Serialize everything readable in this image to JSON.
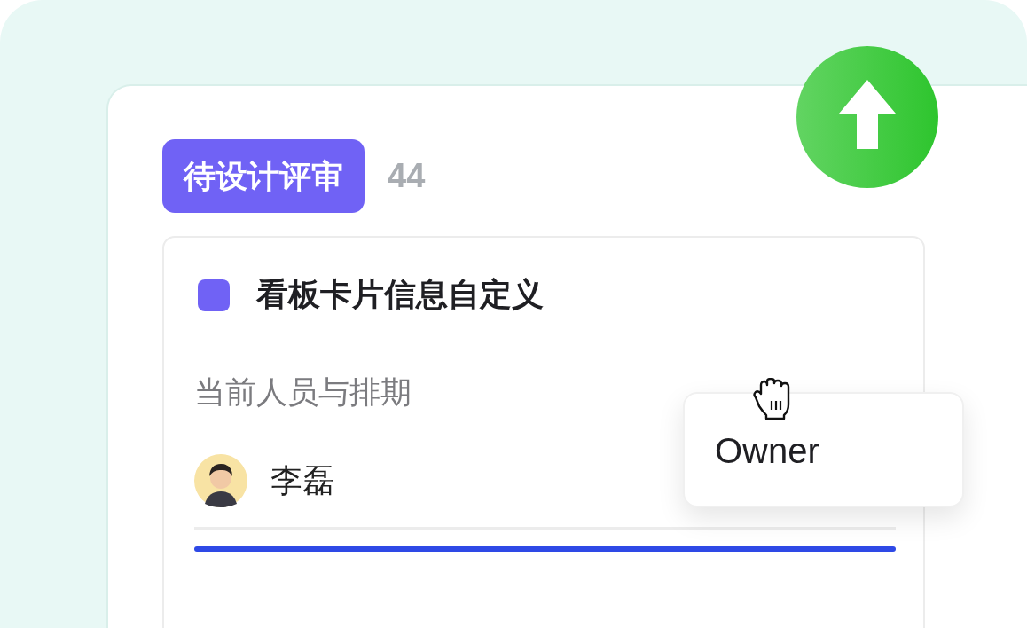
{
  "column": {
    "tag": "待设计评审",
    "count": "44"
  },
  "card": {
    "title": "看板卡片信息自定义",
    "section_label": "当前人员与排期",
    "assignee": {
      "name": "李磊"
    }
  },
  "popover": {
    "label": "Owner"
  }
}
